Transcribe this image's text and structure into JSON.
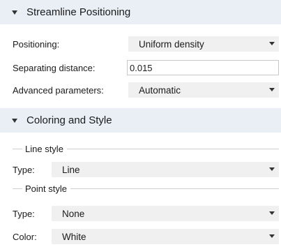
{
  "sections": {
    "streamline": {
      "title": "Streamline Positioning",
      "positioning": {
        "label": "Positioning:",
        "value": "Uniform density"
      },
      "separating": {
        "label": "Separating distance:",
        "value": "0.015"
      },
      "advanced": {
        "label": "Advanced parameters:",
        "value": "Automatic"
      }
    },
    "coloring": {
      "title": "Coloring and Style",
      "line_style": {
        "group_label": "Line style",
        "type_label": "Type:",
        "type_value": "Line"
      },
      "point_style": {
        "group_label": "Point style",
        "type_label": "Type:",
        "type_value": "None",
        "color_label": "Color:",
        "color_value": "White"
      }
    }
  },
  "colors": {
    "header_bg": "#e9eff5",
    "combo_bg": "#f0f0f0"
  },
  "icons": {
    "section_toggle": "chevron-down-icon",
    "dropdown": "chevron-down-icon"
  }
}
